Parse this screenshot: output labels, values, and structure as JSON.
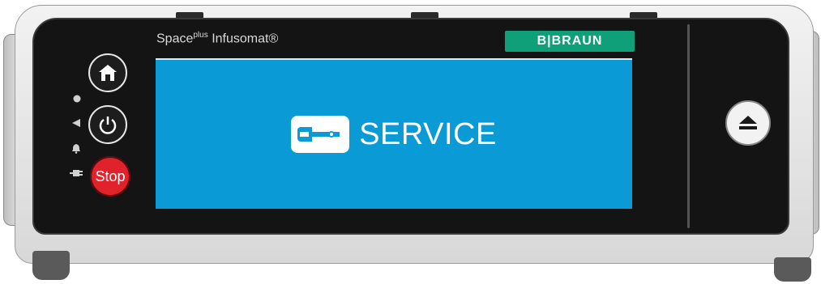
{
  "device": {
    "model_prefix": "Space",
    "model_sup": "plus",
    "model_name": "Infusomat®",
    "brand": "B|BRAUN"
  },
  "screen": {
    "status_label": "SERVICE",
    "status_icon": "wrench-icon",
    "background_color": "#0a9ad6"
  },
  "controls": {
    "home": "home-icon",
    "power": "power-icon",
    "stop_label": "Stop",
    "eject": "eject-icon"
  },
  "indicators": [
    "status-dot-icon",
    "pause-triangle-icon",
    "alarm-bell-icon",
    "power-plug-icon"
  ],
  "colors": {
    "brand_green": "#0f9f79",
    "stop_red": "#e1222b",
    "panel": "#141414"
  }
}
